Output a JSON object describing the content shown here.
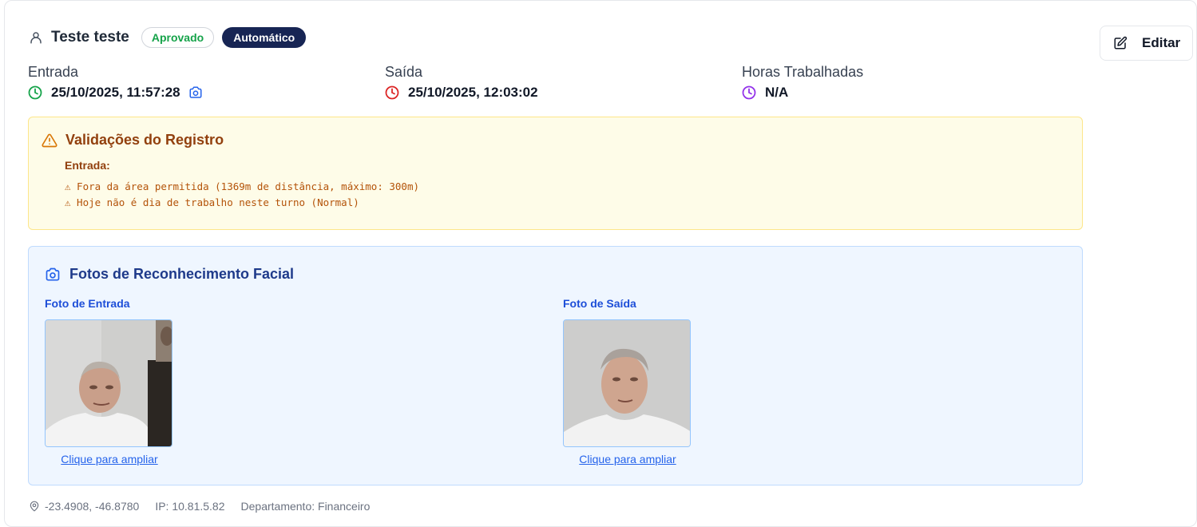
{
  "record": {
    "employee_name": "Teste teste",
    "status_badge": "Aprovado",
    "type_badge": "Automático"
  },
  "actions": {
    "edit_label": "Editar"
  },
  "times": {
    "entry_label": "Entrada",
    "entry_value": "25/10/2025, 11:57:28",
    "exit_label": "Saída",
    "exit_value": "25/10/2025, 12:03:02",
    "hours_label": "Horas Trabalhadas",
    "hours_value": "N/A"
  },
  "validations": {
    "title": "Validações do Registro",
    "section_label": "Entrada:",
    "items": [
      "⚠ Fora da área permitida (1369m de distância, máximo: 300m)",
      "⚠ Hoje não é dia de trabalho neste turno (Normal)"
    ]
  },
  "photos": {
    "title": "Fotos de Reconhecimento Facial",
    "entry_caption": "Foto de Entrada",
    "exit_caption": "Foto de Saída",
    "enlarge_label": "Clique para ampliar"
  },
  "footer": {
    "coordinates": "-23.4908, -46.8780",
    "ip": "IP: 10.81.5.82",
    "department": "Departamento: Financeiro"
  },
  "colors": {
    "entry_clock": "#16a34a",
    "exit_clock": "#dc2626",
    "hours_clock": "#9333ea",
    "approved_badge_text": "#16a34a",
    "auto_badge_bg": "#172554",
    "warning_bg": "#fefce8",
    "photo_panel_bg": "#eff6ff"
  },
  "icons": {
    "user": "user-icon",
    "edit": "edit-icon",
    "entry_clock": "clock-icon",
    "entry_camera": "camera-icon",
    "exit_clock": "clock-icon",
    "hours_clock": "clock-icon",
    "warning": "warning-triangle-icon",
    "photo_section": "camera-icon",
    "location": "map-pin-icon"
  }
}
